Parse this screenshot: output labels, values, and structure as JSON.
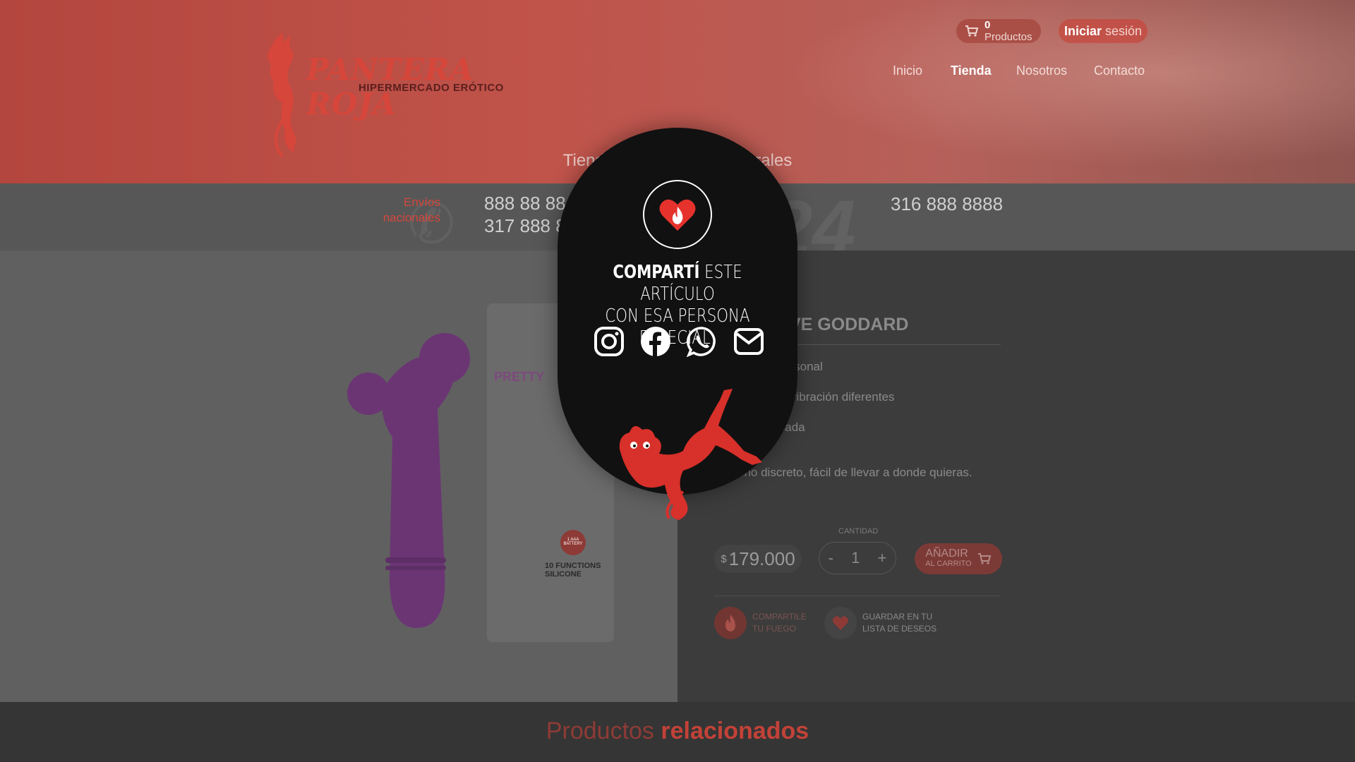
{
  "header": {
    "logo_title": "PANTERA ROJA",
    "logo_subtitle": "HIPERMERCADO ERÓTICO",
    "cart_count": "0",
    "cart_label": "Productos",
    "login_bold": "Iniciar",
    "login_rest": "sesión",
    "nav": [
      "Inicio",
      "Tienda",
      "Nosotros",
      "Contacto"
    ],
    "tagline": "Tiend                                rales"
  },
  "contact": {
    "envios_label": "Envíos\nnacionales",
    "phone_a1": "888 88 88",
    "phone_a2": "317 888 88",
    "phone_b": "316 888 8888",
    "big_number": "24"
  },
  "product": {
    "title_visible": "VE GODDARD",
    "features": [
      "ersonal",
      "vibración diferentes",
      "icada",
      "eño discreto, fácil de llevar a donde quieras."
    ],
    "qty_label": "CANTIDAD",
    "currency_symbol": "$",
    "price": "179.000",
    "qty_minus": "-",
    "qty_value": "1",
    "qty_plus": "+",
    "add_main": "AÑADIR",
    "add_sub": "AL CARRITO",
    "share_line1": "COMPARTILE",
    "share_line2": "TU FUEGO",
    "wish_line1": "GUARDAR EN TU",
    "wish_line2": "LISTA DE DESEOS",
    "package_brand": "PRETTY",
    "package_silicone": "10 FUNCTIONS\nSILICONE",
    "package_battery": "1 AAA\nBATTERY"
  },
  "related": {
    "light": "Productos",
    "bold": "relacionados"
  },
  "modal": {
    "line1_bold": "COMPARTÍ",
    "line1_rest": "ESTE ARTÍCULO",
    "line2": "CON ESA PERSONA ESPECIAL:",
    "social": [
      "instagram-icon",
      "facebook-icon",
      "whatsapp-icon",
      "mail-icon"
    ]
  },
  "colors": {
    "brand_red": "#d6463a",
    "modal_bg": "#111111",
    "overlay_grey": "#3c3c3c"
  }
}
